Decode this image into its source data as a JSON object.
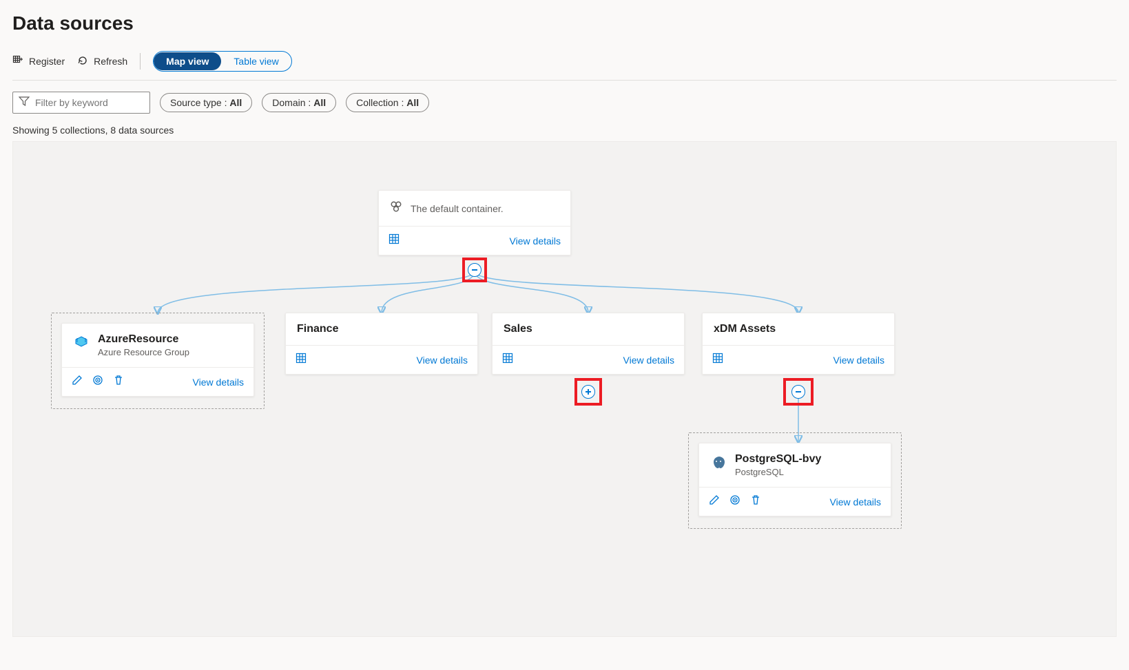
{
  "page_title": "Data sources",
  "toolbar": {
    "register": "Register",
    "refresh": "Refresh",
    "views": {
      "map": "Map view",
      "table": "Table view"
    }
  },
  "filters": {
    "placeholder": "Filter by keyword",
    "source_type_label": "Source type : ",
    "source_type_value": "All",
    "domain_label": "Domain : ",
    "domain_value": "All",
    "collection_label": "Collection : ",
    "collection_value": "All"
  },
  "summary": "Showing 5 collections, 8 data sources",
  "view_details_label": "View details",
  "root": {
    "description": "The default container."
  },
  "collections": {
    "finance": {
      "name": "Finance"
    },
    "sales": {
      "name": "Sales"
    },
    "xdm": {
      "name": "xDM Assets"
    }
  },
  "sources": {
    "azure_resource": {
      "name": "AzureResource",
      "type": "Azure Resource Group"
    },
    "postgres": {
      "name": "PostgreSQL-bvy",
      "type": "PostgreSQL"
    }
  }
}
